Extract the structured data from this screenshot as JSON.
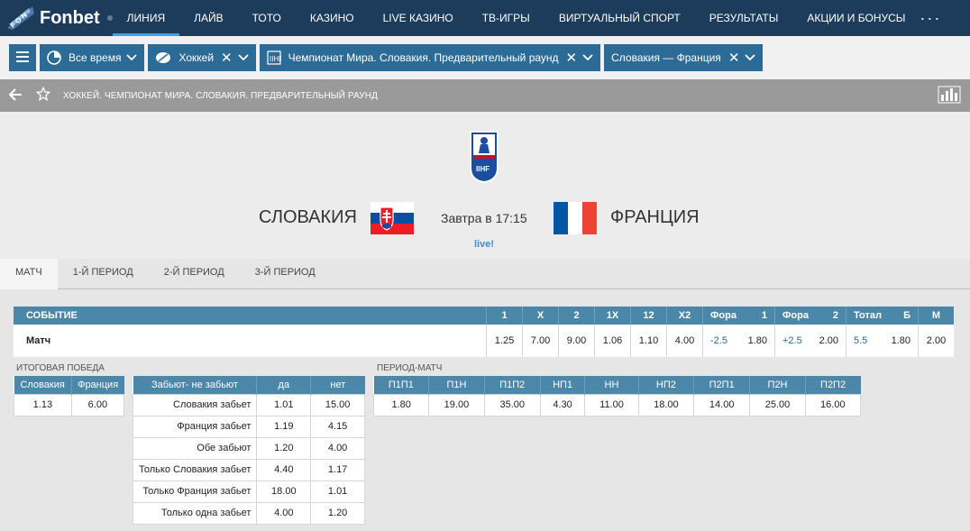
{
  "brand": {
    "name": "Fonbet"
  },
  "nav": {
    "items": [
      "ЛИНИЯ",
      "ЛАЙВ",
      "ТОТО",
      "КАЗИНО",
      "LIVE КАЗИНО",
      "ТВ-ИГРЫ",
      "ВИРТУАЛЬНЫЙ СПОРТ",
      "РЕЗУЛЬТАТЫ",
      "АКЦИИ И БОНУСЫ"
    ],
    "more": "···"
  },
  "filters": {
    "time": "Все время",
    "sport": "Хоккей",
    "tournament": "Чемпионат Мира. Словакия. Предварительный раунд",
    "event": "Словакия — Франция"
  },
  "breadcrumb": "ХОККЕЙ. ЧЕМПИОНАТ МИРА. СЛОВАКИЯ. ПРЕДВАРИТЕЛЬНЫЙ РАУНД",
  "event": {
    "team1": "СЛОВАКИЯ",
    "team2": "ФРАНЦИЯ",
    "time": "Завтра в 17:15",
    "live": "live!",
    "league_logo": "IIHF"
  },
  "tabs": [
    "МАТЧ",
    "1-Й ПЕРИОД",
    "2-Й ПЕРИОД",
    "3-Й ПЕРИОД"
  ],
  "main_table": {
    "headers": [
      "СОБЫТИЕ",
      "1",
      "X",
      "2",
      "1X",
      "12",
      "X2",
      "Фора",
      "1",
      "Фора",
      "2",
      "Тотал",
      "Б",
      "М"
    ],
    "row": [
      "Матч",
      "1.25",
      "7.00",
      "9.00",
      "1.06",
      "1.10",
      "4.00",
      "-2.5",
      "1.80",
      "+2.5",
      "2.00",
      "5.5",
      "1.80",
      "2.00"
    ]
  },
  "winner": {
    "title": "ИТОГОВАЯ ПОБЕДА",
    "headers": [
      "Словакия",
      "Франция"
    ],
    "values": [
      "1.13",
      "6.00"
    ]
  },
  "goals": {
    "headers": [
      "Забьют- не забьют",
      "да",
      "нет"
    ],
    "rows": [
      [
        "Словакия забьет",
        "1.01",
        "15.00"
      ],
      [
        "Франция забьет",
        "1.19",
        "4.15"
      ],
      [
        "Обе забьют",
        "1.20",
        "4.00"
      ],
      [
        "Только Словакия забьет",
        "4.40",
        "1.17"
      ],
      [
        "Только Франция забьет",
        "18.00",
        "1.01"
      ],
      [
        "Только одна забьет",
        "4.00",
        "1.20"
      ]
    ]
  },
  "period_match": {
    "title": "ПЕРИОД-МАТЧ",
    "headers": [
      "П1П1",
      "П1Н",
      "П1П2",
      "НП1",
      "НН",
      "НП2",
      "П2П1",
      "П2Н",
      "П2П2"
    ],
    "values": [
      "1.80",
      "19.00",
      "35.00",
      "4.30",
      "11.00",
      "18.00",
      "14.00",
      "25.00",
      "16.00"
    ]
  },
  "colors": {
    "nav_bg": "#1d3b5a",
    "accent": "#2c6b96",
    "table_header": "#4b87a8",
    "live": "#3b8fd0"
  }
}
